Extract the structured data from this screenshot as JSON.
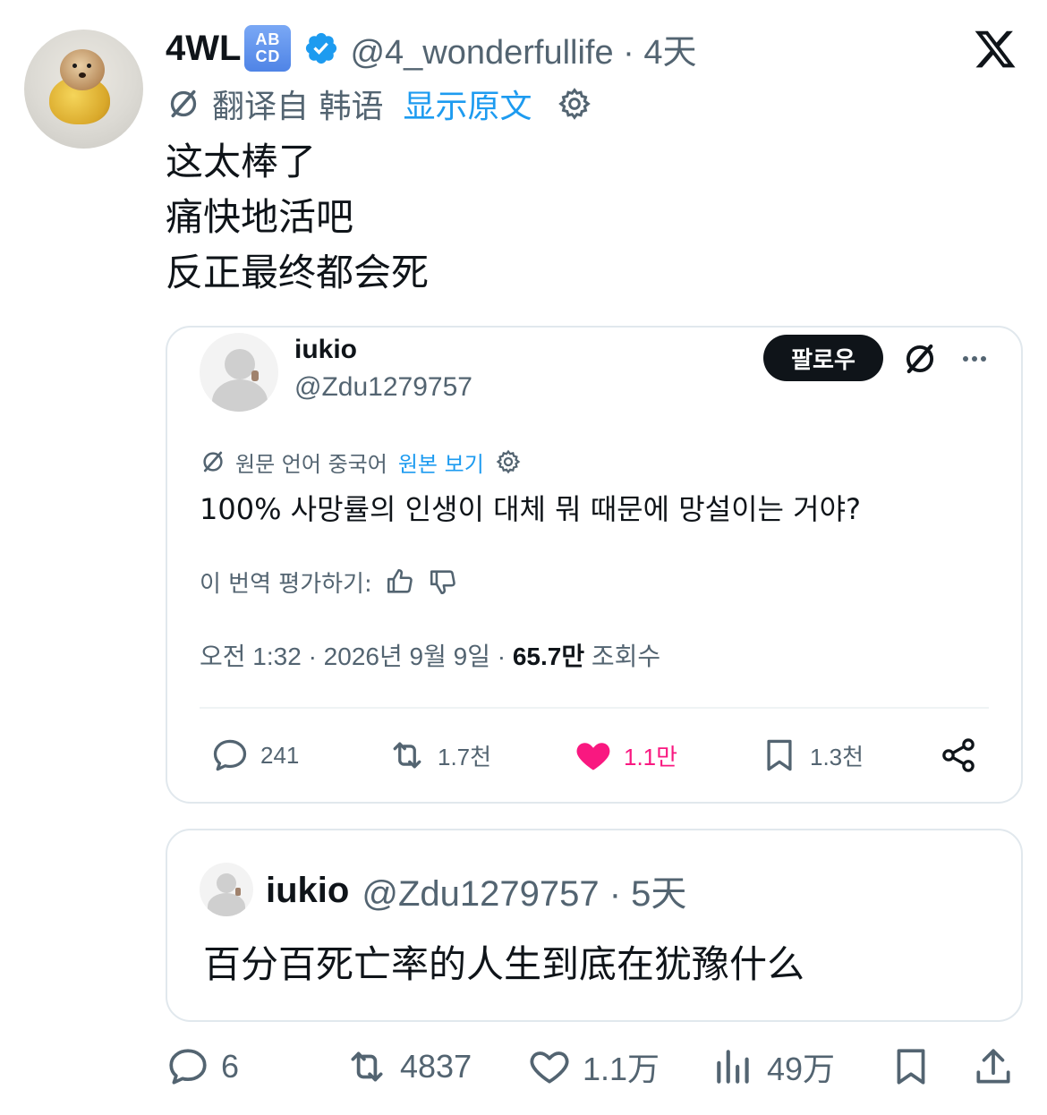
{
  "header": {
    "display_name": "4WL",
    "badge_top": "AB",
    "badge_bottom": "CD",
    "handle_time": "@4_wonderfullife · 4天"
  },
  "translation": {
    "notice": "翻译自 韩语",
    "show_original": "显示原文"
  },
  "post": {
    "lines": [
      "这太棒了",
      "痛快地活吧",
      "反正最终都会死"
    ]
  },
  "quoted_post": {
    "name": "iukio",
    "handle": "@Zdu1279757",
    "follow_label": "팔로우",
    "translation_notice": "원문 언어 중국어",
    "show_original": "원본 보기",
    "text": "100% 사망률의 인생이 대체 뭐 때문에 망설이는 거야?",
    "rate_label": "이 번역 평가하기:",
    "meta_prefix": "오전 1:32 · 2026년 9월 9일 · ",
    "views_count": "65.7만",
    "views_label": " 조회수",
    "actions": {
      "replies": "241",
      "reposts": "1.7천",
      "likes": "1.1만",
      "bookmarks": "1.3천"
    },
    "colors": {
      "like": "#f91880"
    }
  },
  "embedded_post": {
    "name": "iukio",
    "handle_time": "@Zdu1279757 · 5天",
    "text": "百分百死亡率的人生到底在犹豫什么"
  },
  "actions": {
    "replies": "6",
    "reposts": "4837",
    "likes": "1.1万",
    "views": "49万"
  },
  "colors": {
    "link": "#1d9bf0",
    "verified": "#1d9bf0",
    "text": "#0f1419",
    "secondary": "#536471"
  }
}
